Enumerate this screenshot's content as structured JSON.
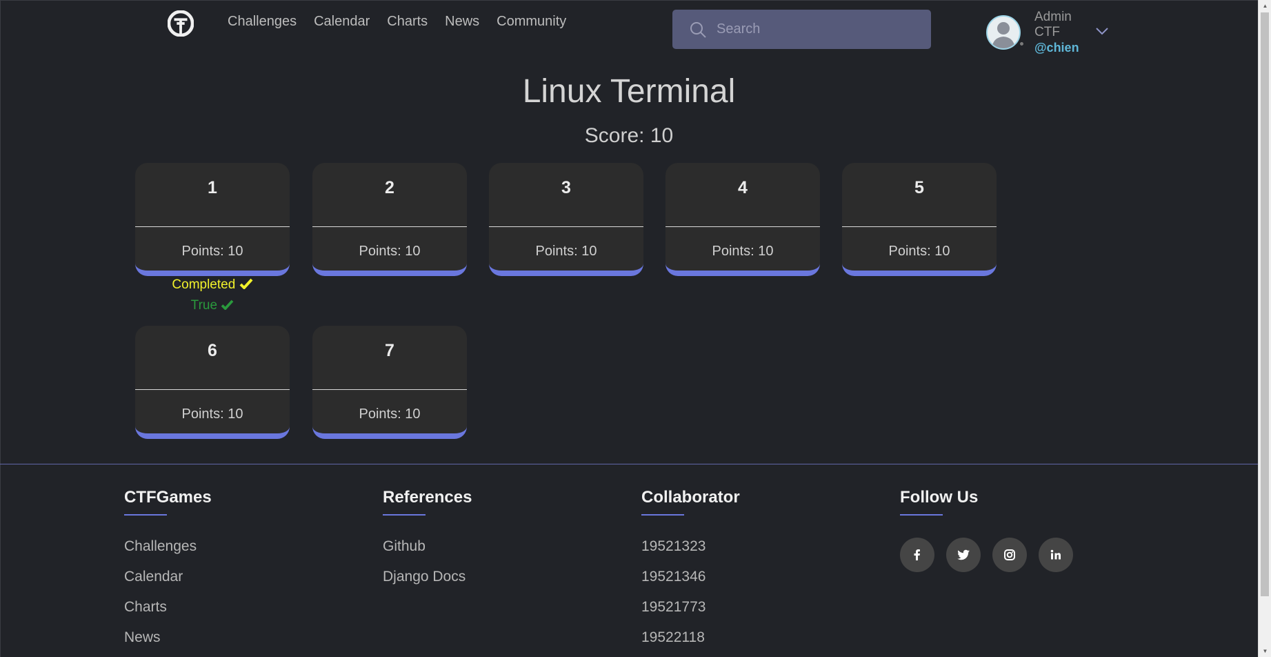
{
  "nav": {
    "items": [
      {
        "label": "Challenges"
      },
      {
        "label": "Calendar"
      },
      {
        "label": "Charts"
      },
      {
        "label": "News"
      },
      {
        "label": "Community"
      }
    ]
  },
  "search": {
    "placeholder": "Search",
    "value": ""
  },
  "user": {
    "name": "Admin CTF",
    "handle": "@chien"
  },
  "page": {
    "title": "Linux Terminal",
    "score": "Score: 10"
  },
  "challenges": [
    {
      "number": "1",
      "points": "Points: 10"
    },
    {
      "number": "2",
      "points": "Points: 10"
    },
    {
      "number": "3",
      "points": "Points: 10"
    },
    {
      "number": "4",
      "points": "Points: 10"
    },
    {
      "number": "5",
      "points": "Points: 10"
    },
    {
      "number": "6",
      "points": "Points: 10"
    },
    {
      "number": "7",
      "points": "Points: 10"
    }
  ],
  "challenge_status": {
    "completed": "Completed",
    "result": "True"
  },
  "footer": {
    "ctfgames": {
      "title": "CTFGames",
      "links": [
        "Challenges",
        "Calendar",
        "Charts",
        "News"
      ]
    },
    "references": {
      "title": "References",
      "links": [
        "Github",
        "Django Docs"
      ]
    },
    "collaborator": {
      "title": "Collaborator",
      "items": [
        "19521323",
        "19521346",
        "19521773",
        "19522118"
      ]
    },
    "follow": {
      "title": "Follow Us",
      "icons": [
        "facebook-icon",
        "twitter-icon",
        "instagram-icon",
        "linkedin-icon"
      ]
    }
  },
  "colors": {
    "background": "#212328",
    "accent": "#6a77de",
    "completed": "#f2f22b",
    "true": "#2a9a3d",
    "handle": "#5fb7d8"
  }
}
